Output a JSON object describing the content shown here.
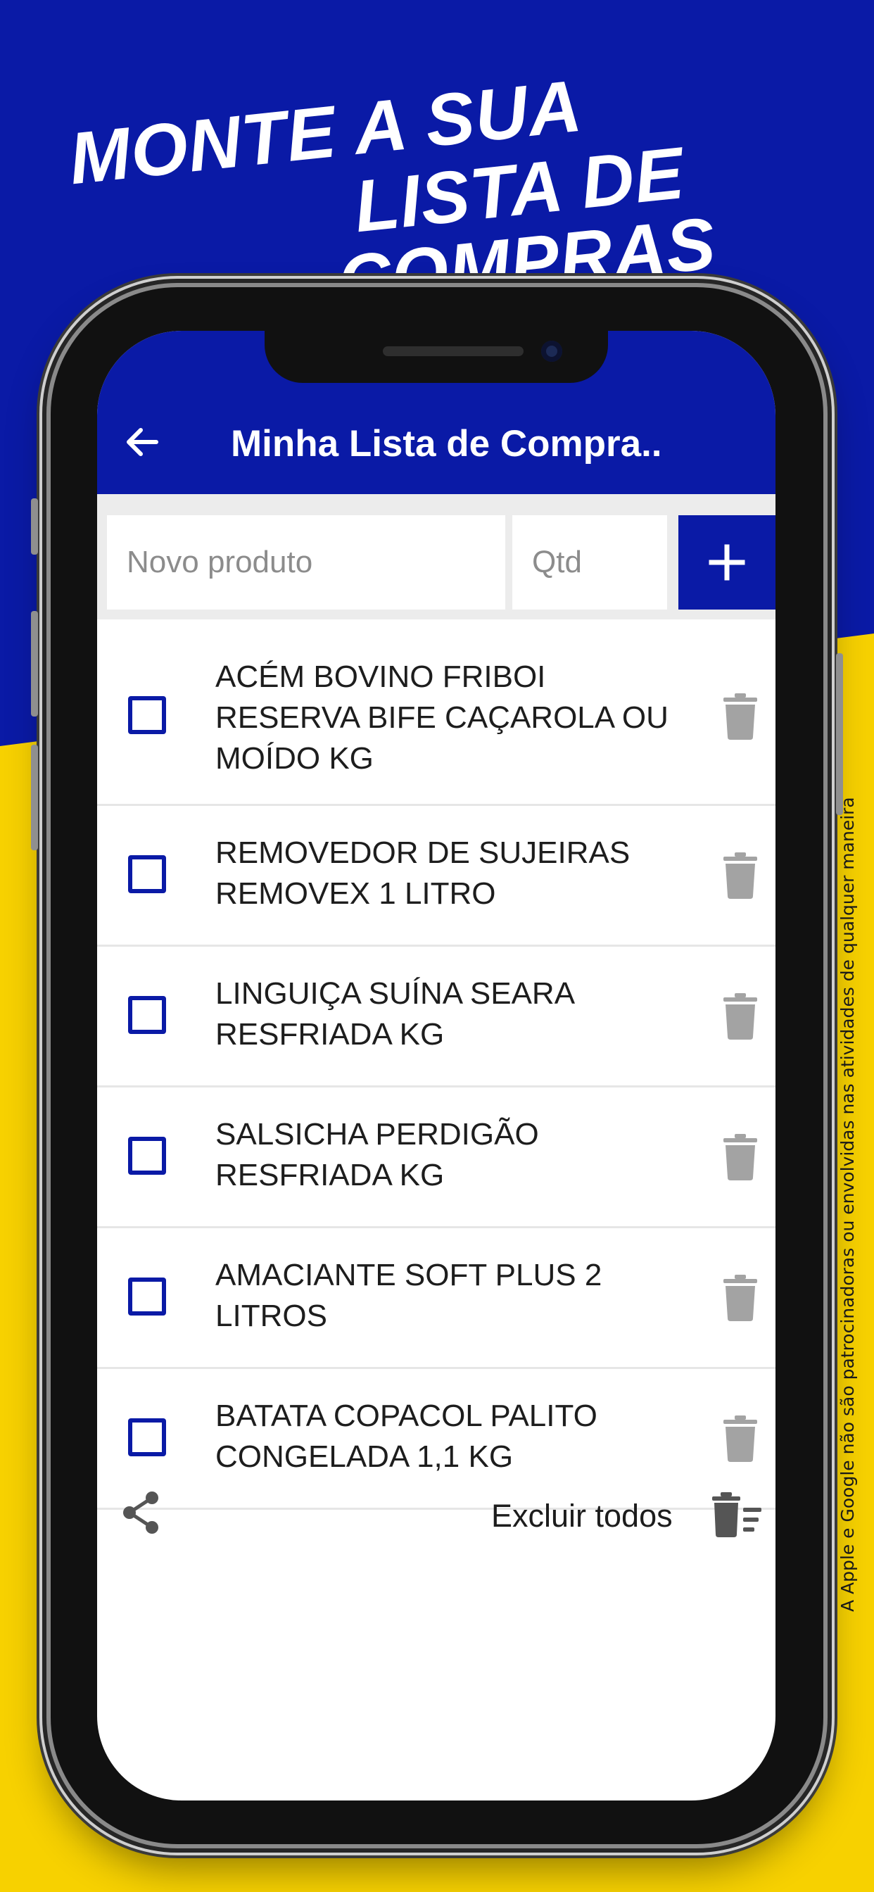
{
  "headline": {
    "line1": "MONTE A SUA",
    "line2": "LISTA DE COMPRAS"
  },
  "disclaimer": "A Apple e Google não são patrocinadoras ou envolvidas nas atividades de qualquer maneira",
  "colors": {
    "brand_blue": "#0a1aa6",
    "brand_yellow": "#f7d100",
    "trash_gray": "#a3a3a3"
  },
  "appbar": {
    "title": "Minha Lista de Compra..",
    "back_icon": "arrow-left-icon"
  },
  "inputs": {
    "product_placeholder": "Novo produto",
    "product_value": "",
    "qty_placeholder": "Qtd",
    "qty_value": "",
    "add_icon": "plus-icon"
  },
  "items": [
    {
      "label": "ACÉM BOVINO FRIBOI RESERVA BIFE CAÇAROLA OU MOÍDO KG",
      "checked": false
    },
    {
      "label": "REMOVEDOR DE SUJEIRAS REMOVEX 1 LITRO",
      "checked": false
    },
    {
      "label": "LINGUIÇA SUÍNA SEARA RESFRIADA KG",
      "checked": false
    },
    {
      "label": "SALSICHA PERDIGÃO RESFRIADA KG",
      "checked": false
    },
    {
      "label": "AMACIANTE SOFT PLUS 2 LITROS",
      "checked": false
    },
    {
      "label": "BATATA COPACOL PALITO CONGELADA 1,1 KG",
      "checked": false
    }
  ],
  "footer": {
    "share_icon": "share-icon",
    "clear_all_label": "Excluir todos",
    "clear_all_icon": "trash-list-icon"
  }
}
